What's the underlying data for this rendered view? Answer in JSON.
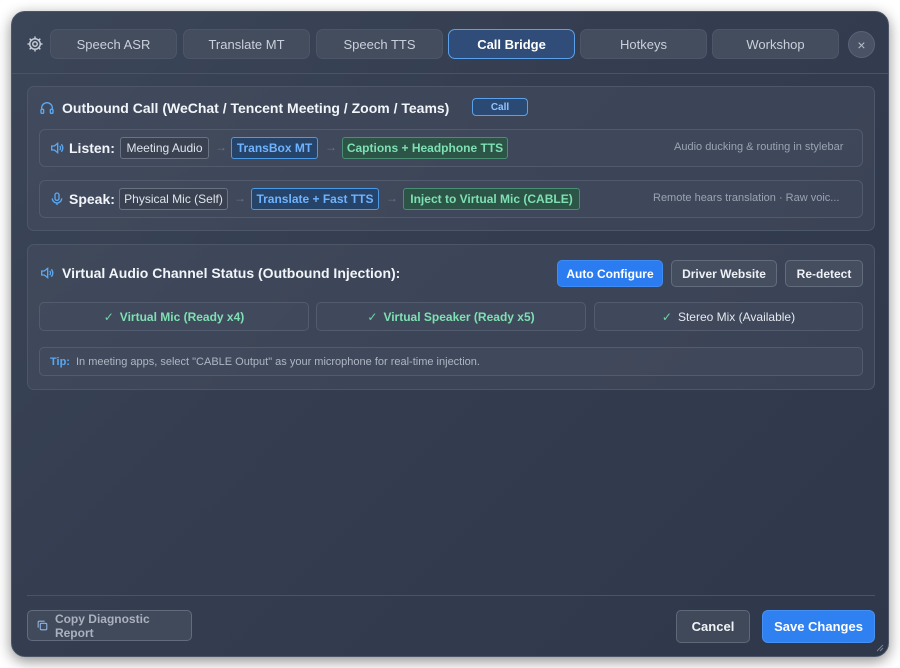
{
  "tabs": [
    {
      "label": "Speech ASR",
      "active": false
    },
    {
      "label": "Translate MT",
      "active": false
    },
    {
      "label": "Speech TTS",
      "active": false
    },
    {
      "label": "Call Bridge",
      "active": true
    },
    {
      "label": "Hotkeys",
      "active": false
    },
    {
      "label": "Workshop",
      "active": false
    }
  ],
  "close_glyph": "×",
  "outbound": {
    "title": "Outbound Call (WeChat / Tencent Meeting / Zoom / Teams)",
    "badge": "Call",
    "icon": "headphones-icon",
    "listen": {
      "label": "Listen:",
      "icon": "speaker-icon",
      "source": "Meeting Audio",
      "engine": "TransBox MT",
      "output": "Captions + Headphone TTS",
      "note": "Audio ducking & routing in stylebar"
    },
    "speak": {
      "label": "Speak:",
      "icon": "microphone-icon",
      "source": "Physical Mic (Self)",
      "engine": "Translate + Fast TTS",
      "output": "Inject to Virtual Mic (CABLE)",
      "note": "Remote hears translation · Raw voic..."
    },
    "arrow": "→"
  },
  "virtual": {
    "title": "Virtual Audio Channel Status (Outbound Injection):",
    "icon": "speaker-icon",
    "buttons": {
      "auto_configure": "Auto Configure",
      "driver_website": "Driver Website",
      "redetect": "Re-detect"
    },
    "statuses": [
      {
        "label": "Virtual Mic (Ready x4)",
        "check": "✓"
      },
      {
        "label": "Virtual Speaker (Ready x5)",
        "check": "✓"
      },
      {
        "label": "Stereo Mix (Available)",
        "check": "✓"
      }
    ],
    "tip_label": "Tip:",
    "tip_text": "In meeting apps, select \"CABLE Output\" as your microphone for real-time injection."
  },
  "footer": {
    "diagnostic": "Copy Diagnostic Report",
    "cancel": "Cancel",
    "save": "Save Changes"
  },
  "colors": {
    "accent": "#2f81f2",
    "active_tab_border": "#5aa0ea",
    "green_text": "#7ee0b3",
    "blue_text": "#6fb3ff"
  }
}
